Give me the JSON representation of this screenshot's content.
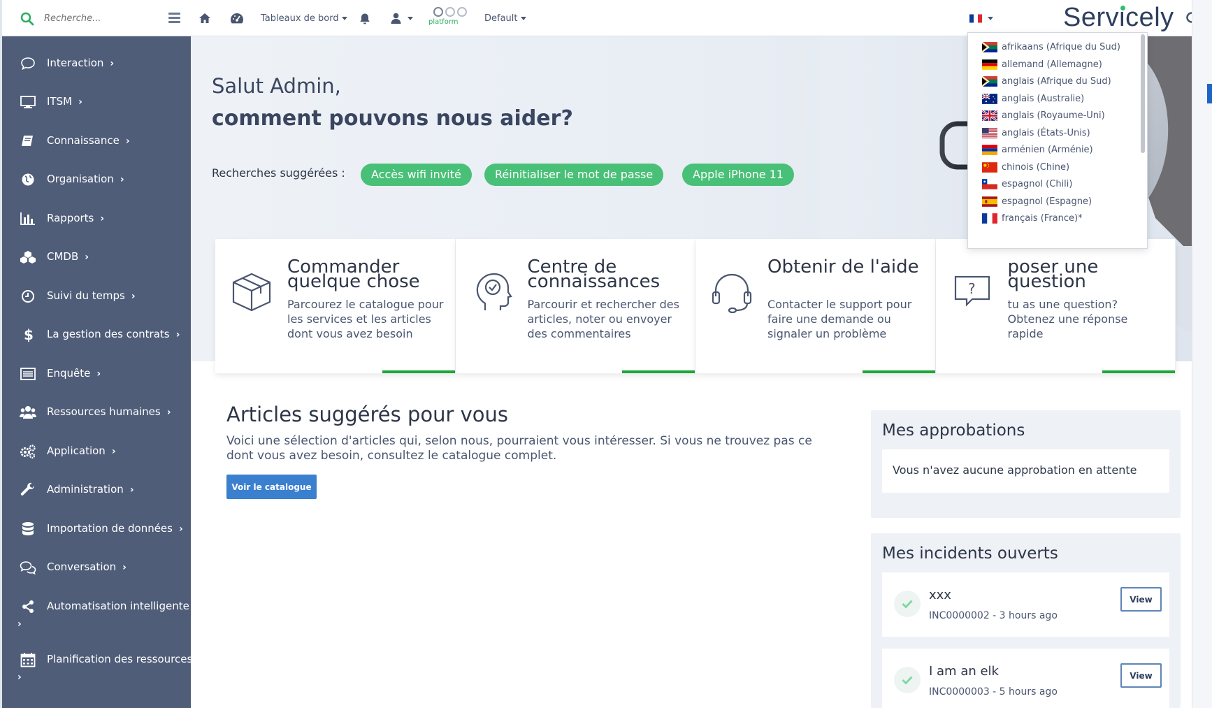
{
  "sidebar": {
    "search_placeholder": "Recherche...",
    "items": [
      {
        "label": "Interaction",
        "icon": "chat-bubble-icon"
      },
      {
        "label": "ITSM",
        "icon": "monitor-icon"
      },
      {
        "label": "Connaissance",
        "icon": "book-icon"
      },
      {
        "label": "Organisation",
        "icon": "globe-icon"
      },
      {
        "label": "Rapports",
        "icon": "bar-chart-icon"
      },
      {
        "label": "CMDB",
        "icon": "cubes-icon"
      },
      {
        "label": "Suivi du temps",
        "icon": "clock-icon"
      },
      {
        "label": "La gestion des contrats",
        "icon": "dollar-icon"
      },
      {
        "label": "Enquête",
        "icon": "list-icon"
      },
      {
        "label": "Ressources humaines",
        "icon": "users-icon"
      },
      {
        "label": "Application",
        "icon": "gears-icon"
      },
      {
        "label": "Administration",
        "icon": "wrench-icon"
      },
      {
        "label": "Importation de données",
        "icon": "database-icon"
      },
      {
        "label": "Conversation",
        "icon": "chat-bubbles-icon"
      },
      {
        "label": "Automatisation intelligente",
        "icon": "share-nodes-icon"
      },
      {
        "label": "Planification des ressources",
        "icon": "calendar-icon"
      }
    ]
  },
  "topbar": {
    "dashboards_label": "Tableaux de bord",
    "platform_label": "platform",
    "default_label": "Default",
    "brand": "Servicely",
    "brand_parts": {
      "before": "Serv",
      "accent": "i",
      "after": "cely"
    }
  },
  "hero": {
    "greeting": "Salut Admin,",
    "question": "comment pouvons nous aider?",
    "suggested_label": "Recherches suggérées :",
    "suggestions": [
      "Accès wifi invité",
      "Réinitialiser le mot de passe",
      "Apple iPhone 11"
    ]
  },
  "cards": [
    {
      "title": "Commander quelque chose",
      "desc": "Parcourez le catalogue pour les services et les articles dont vous avez besoin",
      "icon": "box-icon"
    },
    {
      "title": "Centre de connaissances",
      "desc": "Parcourir et rechercher des articles, noter ou envoyer des commentaires",
      "icon": "head-check-icon"
    },
    {
      "title": "Obtenir de l'aide",
      "desc": "Contacter le support pour faire une demande ou signaler un problème",
      "icon": "headset-icon"
    },
    {
      "title": "poser une question",
      "desc": "tu as une question? Obtenez une réponse rapide",
      "icon": "question-bubble-icon"
    }
  ],
  "articles": {
    "title": "Articles suggérés pour vous",
    "desc": "Voici une sélection d'articles qui, selon nous, pourraient vous intéresser. Si vous ne trouvez pas ce dont vous avez besoin, consultez le catalogue complet.",
    "button": "Voir le catalogue"
  },
  "approvals": {
    "title": "Mes approbations",
    "empty": "Vous n'avez aucune approbation en attente"
  },
  "incidents": {
    "title": "Mes incidents ouverts",
    "items": [
      {
        "title": "xxx",
        "sub": "INC0000002 - 3 hours ago",
        "button": "View"
      },
      {
        "title": "I am an elk",
        "sub": "INC0000003 - 5 hours ago",
        "button": "View"
      }
    ]
  },
  "languages": [
    {
      "label": "afrikaans (Afrique du Sud)",
      "flag": "za"
    },
    {
      "label": "allemand (Allemagne)",
      "flag": "de"
    },
    {
      "label": "anglais (Afrique du Sud)",
      "flag": "za"
    },
    {
      "label": "anglais (Australie)",
      "flag": "au"
    },
    {
      "label": "anglais (Royaume-Uni)",
      "flag": "gb"
    },
    {
      "label": "anglais (États-Unis)",
      "flag": "us"
    },
    {
      "label": "arménien (Arménie)",
      "flag": "am"
    },
    {
      "label": "chinois (Chine)",
      "flag": "cn"
    },
    {
      "label": "espagnol (Chili)",
      "flag": "cl"
    },
    {
      "label": "espagnol (Espagne)",
      "flag": "es"
    },
    {
      "label": "français (France)*",
      "flag": "fr"
    }
  ],
  "colors": {
    "sidebar": "#4f5d79",
    "accent_green": "#49c077",
    "card_bar": "#1fa53a",
    "primary_button": "#3b7fcf"
  }
}
